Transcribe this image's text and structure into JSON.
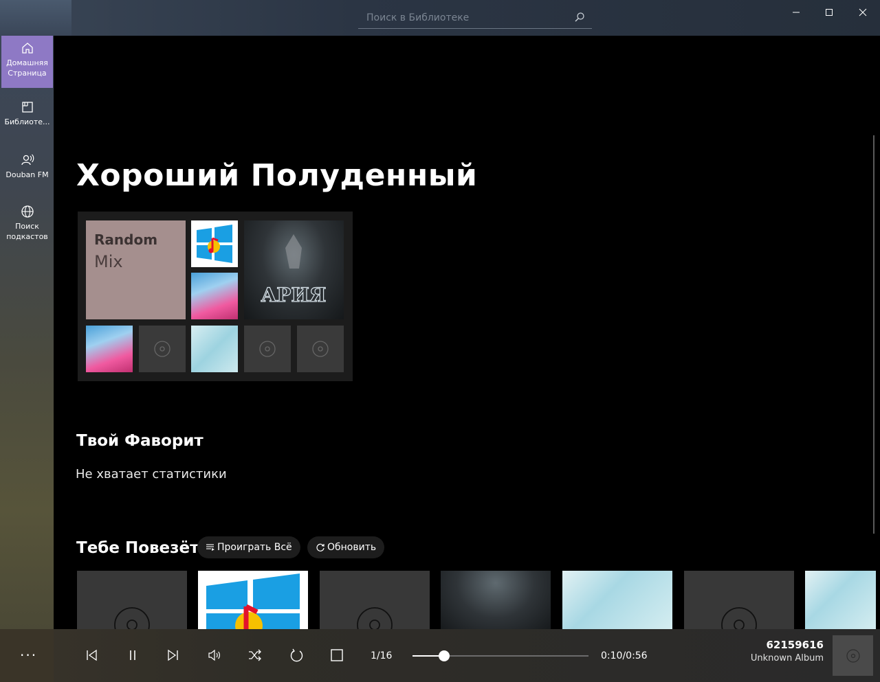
{
  "search": {
    "placeholder": "Поиск в Библиотеке"
  },
  "sidebar": {
    "items": [
      {
        "label": "Домашняя Страница",
        "icon": "home-icon",
        "active": true
      },
      {
        "label": "Библиоте...",
        "icon": "library-icon",
        "active": false
      },
      {
        "label": "Douban FM",
        "icon": "radio-icon",
        "active": false
      },
      {
        "label": "Поиск подкастов",
        "icon": "globe-icon",
        "active": false
      }
    ],
    "more_label": "···"
  },
  "main": {
    "greeting": "Хороший Полуденный",
    "random_mix": {
      "line1": "Random",
      "line2": "Mix"
    },
    "favorite": {
      "title": "Твой Фаворит",
      "empty_text": "Не хватает статистики"
    },
    "lucky": {
      "title": "Тебе Повезёт",
      "play_all_label": "Проиграть Всё",
      "refresh_label": "Обновить"
    }
  },
  "player": {
    "counter": "1/16",
    "time": "0:10/0:56",
    "progress_fraction": 0.18,
    "title": "62159616",
    "album": "Unknown Album"
  },
  "colors": {
    "accent": "#8e79c5",
    "random_mix_bg": "#a58f8e"
  }
}
